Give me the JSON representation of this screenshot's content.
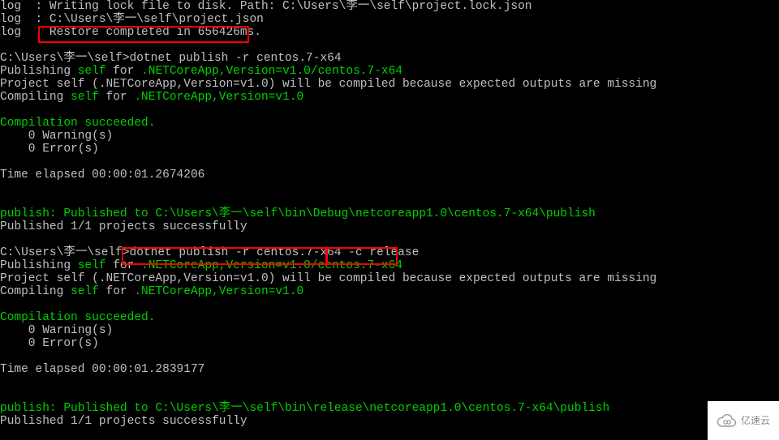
{
  "lines": [
    {
      "parts": [
        {
          "t": "log  : Writing lock file to disk. Path: C:\\Users\\李一\\self\\project.lock.json",
          "c": "w"
        }
      ]
    },
    {
      "parts": [
        {
          "t": "log  : C:\\Users\\李一\\self\\project.json",
          "c": "w"
        }
      ]
    },
    {
      "parts": [
        {
          "t": "log  : Restore completed in 656426ms.",
          "c": "w"
        }
      ]
    },
    {
      "parts": [
        {
          "t": "",
          "c": "w"
        }
      ]
    },
    {
      "parts": [
        {
          "t": "C:\\Users\\李一\\self>dotnet publish -r centos.7-x64",
          "c": "w"
        }
      ]
    },
    {
      "parts": [
        {
          "t": "Publishing ",
          "c": "w"
        },
        {
          "t": "self",
          "c": "g"
        },
        {
          "t": " for ",
          "c": "w"
        },
        {
          "t": ".NETCoreApp,Version=v1.0/centos.7-x64",
          "c": "g"
        }
      ]
    },
    {
      "parts": [
        {
          "t": "Project self (.NETCoreApp,Version=v1.0) will be compiled because expected outputs are missing",
          "c": "w"
        }
      ]
    },
    {
      "parts": [
        {
          "t": "Compiling ",
          "c": "w"
        },
        {
          "t": "self",
          "c": "g"
        },
        {
          "t": " for ",
          "c": "w"
        },
        {
          "t": ".NETCoreApp,Version=v1.0",
          "c": "g"
        }
      ]
    },
    {
      "parts": [
        {
          "t": "",
          "c": "w"
        }
      ]
    },
    {
      "parts": [
        {
          "t": "Compilation succeeded.",
          "c": "g"
        }
      ]
    },
    {
      "parts": [
        {
          "t": "    0 Warning(s)",
          "c": "w"
        }
      ]
    },
    {
      "parts": [
        {
          "t": "    0 Error(s)",
          "c": "w"
        }
      ]
    },
    {
      "parts": [
        {
          "t": "",
          "c": "w"
        }
      ]
    },
    {
      "parts": [
        {
          "t": "Time elapsed 00:00:01.2674206",
          "c": "w"
        }
      ]
    },
    {
      "parts": [
        {
          "t": " ",
          "c": "w"
        }
      ]
    },
    {
      "parts": [
        {
          "t": "",
          "c": "w"
        }
      ]
    },
    {
      "parts": [
        {
          "t": "publish: Published to C:\\Users\\李一\\self\\bin\\Debug\\netcoreapp1.0\\centos.7-x64\\publish",
          "c": "g"
        }
      ]
    },
    {
      "parts": [
        {
          "t": "Published 1/1 projects successfully",
          "c": "w"
        }
      ]
    },
    {
      "parts": [
        {
          "t": "",
          "c": "w"
        }
      ]
    },
    {
      "parts": [
        {
          "t": "C:\\Users\\李一\\self>dotnet publish -r centos.7-x64 -c release",
          "c": "w"
        }
      ]
    },
    {
      "parts": [
        {
          "t": "Publishing ",
          "c": "w"
        },
        {
          "t": "self",
          "c": "g"
        },
        {
          "t": " for ",
          "c": "w"
        },
        {
          "t": ".NETCoreApp,Version=v1.0/centos.7-x64",
          "c": "g"
        }
      ]
    },
    {
      "parts": [
        {
          "t": "Project self (.NETCoreApp,Version=v1.0) will be compiled because expected outputs are missing",
          "c": "w"
        }
      ]
    },
    {
      "parts": [
        {
          "t": "Compiling ",
          "c": "w"
        },
        {
          "t": "self",
          "c": "g"
        },
        {
          "t": " for ",
          "c": "w"
        },
        {
          "t": ".NETCoreApp,Version=v1.0",
          "c": "g"
        }
      ]
    },
    {
      "parts": [
        {
          "t": "",
          "c": "w"
        }
      ]
    },
    {
      "parts": [
        {
          "t": "Compilation succeeded.",
          "c": "g"
        }
      ]
    },
    {
      "parts": [
        {
          "t": "    0 Warning(s)",
          "c": "w"
        }
      ]
    },
    {
      "parts": [
        {
          "t": "    0 Error(s)",
          "c": "w"
        }
      ]
    },
    {
      "parts": [
        {
          "t": "",
          "c": "w"
        }
      ]
    },
    {
      "parts": [
        {
          "t": "Time elapsed 00:00:01.2839177",
          "c": "w"
        }
      ]
    },
    {
      "parts": [
        {
          "t": " ",
          "c": "w"
        }
      ]
    },
    {
      "parts": [
        {
          "t": "",
          "c": "w"
        }
      ]
    },
    {
      "parts": [
        {
          "t": "publish: Published to C:\\Users\\李一\\self\\bin\\release\\netcoreapp1.0\\centos.7-x64\\publish",
          "c": "g"
        }
      ]
    },
    {
      "parts": [
        {
          "t": "Published 1/1 projects successfully",
          "c": "w"
        }
      ]
    }
  ],
  "highlights": {
    "box1_label": "restore-completed-highlight",
    "box2_label": "publish-command-highlight",
    "box3_label": "c-release-highlight"
  },
  "watermark": {
    "text": "亿速云"
  }
}
